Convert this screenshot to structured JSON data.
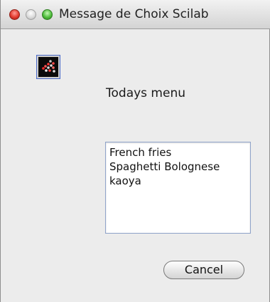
{
  "window": {
    "title": "Message de Choix Scilab"
  },
  "dialog": {
    "message": "Todays menu",
    "choices": [
      "French fries",
      "Spaghetti Bolognese",
      "kaoya"
    ],
    "cancel_label": "Cancel"
  },
  "icons": {
    "close": "close-traffic-light-icon",
    "minimize": "minimize-traffic-light-icon",
    "zoom": "zoom-traffic-light-icon",
    "app": "scilab-logo-icon"
  },
  "colors": {
    "close": "#e23b2f",
    "zoom": "#4fbe3c",
    "list_border": "#8fa3c9"
  }
}
